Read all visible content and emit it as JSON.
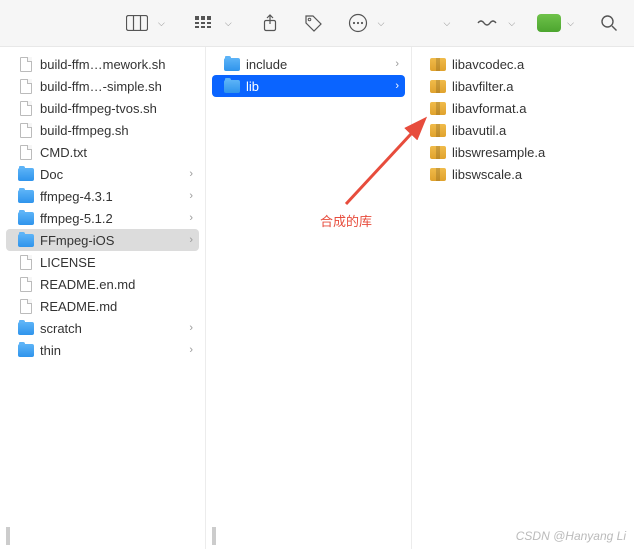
{
  "toolbar": {
    "view_icon": "columns-view",
    "group_icon": "grid-view",
    "share_icon": "share",
    "tag_icon": "tag",
    "more_icon": "more-circle",
    "connect_icon": "connect",
    "color_btn": "green",
    "search_icon": "search"
  },
  "col1": [
    {
      "name": "build-ffm…mework.sh",
      "type": "file",
      "hasChevron": false
    },
    {
      "name": "build-ffm…-simple.sh",
      "type": "file",
      "hasChevron": false
    },
    {
      "name": "build-ffmpeg-tvos.sh",
      "type": "file",
      "hasChevron": false
    },
    {
      "name": "build-ffmpeg.sh",
      "type": "file",
      "hasChevron": false
    },
    {
      "name": "CMD.txt",
      "type": "file",
      "hasChevron": false
    },
    {
      "name": "Doc",
      "type": "folder",
      "hasChevron": true
    },
    {
      "name": "ffmpeg-4.3.1",
      "type": "folder",
      "hasChevron": true
    },
    {
      "name": "ffmpeg-5.1.2",
      "type": "folder",
      "hasChevron": true
    },
    {
      "name": "FFmpeg-iOS",
      "type": "folder",
      "hasChevron": true,
      "selected": "grey"
    },
    {
      "name": "LICENSE",
      "type": "file",
      "hasChevron": false
    },
    {
      "name": "README.en.md",
      "type": "file",
      "hasChevron": false
    },
    {
      "name": "README.md",
      "type": "file",
      "hasChevron": false
    },
    {
      "name": "scratch",
      "type": "folder",
      "hasChevron": true
    },
    {
      "name": "thin",
      "type": "folder",
      "hasChevron": true
    }
  ],
  "col2": [
    {
      "name": "include",
      "type": "folder",
      "hasChevron": true
    },
    {
      "name": "lib",
      "type": "folder",
      "hasChevron": true,
      "selected": "blue"
    }
  ],
  "col3": [
    {
      "name": "libavcodec.a",
      "type": "archive",
      "hasChevron": false
    },
    {
      "name": "libavfilter.a",
      "type": "archive",
      "hasChevron": false
    },
    {
      "name": "libavformat.a",
      "type": "archive",
      "hasChevron": false
    },
    {
      "name": "libavutil.a",
      "type": "archive",
      "hasChevron": false
    },
    {
      "name": "libswresample.a",
      "type": "archive",
      "hasChevron": false
    },
    {
      "name": "libswscale.a",
      "type": "archive",
      "hasChevron": false
    }
  ],
  "annotation": "合成的库",
  "watermark": "CSDN @Hanyang Li"
}
